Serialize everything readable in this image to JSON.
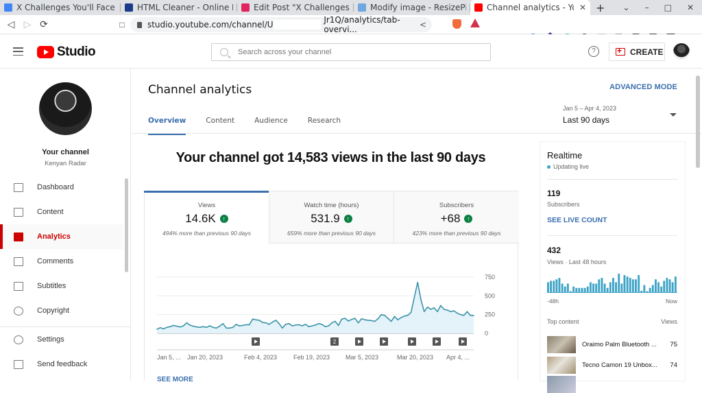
{
  "browser": {
    "tabs": [
      {
        "title": "X Challenges You'll Face Whe",
        "favicon": "docs-icon",
        "color": "#4285f4",
        "active": false
      },
      {
        "title": "HTML Cleaner - Online Beau",
        "favicon": "html-cleaner-icon",
        "color": "#1a3a8a",
        "active": false
      },
      {
        "title": "Edit Post \"X Challenges You'",
        "favicon": "k-icon",
        "color": "#e0245e",
        "active": false
      },
      {
        "title": "Modify image - ResizePixel",
        "favicon": "resizepixel-icon",
        "color": "#6fa8dc",
        "active": false
      },
      {
        "title": "Channel analytics - YouT",
        "favicon": "youtube-icon",
        "color": "#ff0000",
        "active": true
      }
    ],
    "new_tab": "+",
    "url_prefix": "studio.youtube.com/channel/U",
    "url_suffix": "Jr1Q/analytics/tab-overvi..."
  },
  "header": {
    "logo_text": "Studio",
    "search_placeholder": "Search across your channel",
    "help": "?",
    "create_label": "CREATE"
  },
  "sidebar": {
    "channel_title": "Your channel",
    "channel_name": "Kenyan Radar",
    "items": [
      {
        "label": "Dashboard",
        "icon": "dashboard-icon",
        "active": false
      },
      {
        "label": "Content",
        "icon": "content-icon",
        "active": false
      },
      {
        "label": "Analytics",
        "icon": "analytics-icon",
        "active": true
      },
      {
        "label": "Comments",
        "icon": "comments-icon",
        "active": false
      },
      {
        "label": "Subtitles",
        "icon": "subtitles-icon",
        "active": false
      },
      {
        "label": "Copyright",
        "icon": "copyright-icon",
        "active": false
      }
    ],
    "bottom_items": [
      {
        "label": "Settings",
        "icon": "settings-icon"
      },
      {
        "label": "Send feedback",
        "icon": "feedback-icon"
      }
    ]
  },
  "main": {
    "title": "Channel analytics",
    "advanced_mode": "ADVANCED MODE",
    "tabs": [
      "Overview",
      "Content",
      "Audience",
      "Research"
    ],
    "active_tab": "Overview",
    "date_range_small": "Jan 5 – Apr 4, 2023",
    "date_range_label": "Last 90 days",
    "headline": "Your channel got 14,583 views in the last 90 days",
    "metrics": [
      {
        "label": "Views",
        "value": "14.6K",
        "compare": "494% more than previous 90 days",
        "trend": "up"
      },
      {
        "label": "Watch time (hours)",
        "value": "531.9",
        "compare": "659% more than previous 90 days",
        "trend": "up"
      },
      {
        "label": "Subscribers",
        "value": "+68",
        "compare": "423% more than previous 90 days",
        "trend": "up"
      }
    ],
    "see_more": "SEE MORE"
  },
  "chart_data": {
    "type": "area",
    "title": "Views",
    "xlabel": "",
    "ylabel": "",
    "ylim": [
      0,
      750
    ],
    "y_ticks": [
      0,
      250,
      500,
      750
    ],
    "x_tick_labels": [
      "Jan 5, ...",
      "Jan 20, 2023",
      "Feb 4, 2023",
      "Feb 19, 2023",
      "Mar 5, 2023",
      "Mar 20, 2023",
      "Apr 4, ..."
    ],
    "grid": true,
    "line_color": "#3b93a8",
    "fill_color": "#e3f3f9",
    "series": [
      {
        "name": "Views",
        "values": [
          55,
          75,
          60,
          80,
          90,
          105,
          95,
          85,
          100,
          140,
          110,
          95,
          85,
          80,
          90,
          80,
          100,
          80,
          70,
          95,
          130,
          70,
          70,
          80,
          120,
          100,
          105,
          115,
          115,
          190,
          180,
          175,
          145,
          140,
          120,
          150,
          175,
          130,
          70,
          120,
          130,
          100,
          110,
          115,
          100,
          120,
          90,
          100,
          110,
          130,
          120,
          90,
          100,
          140,
          160,
          105,
          190,
          200,
          165,
          185,
          200,
          140,
          195,
          180,
          175,
          170,
          160,
          195,
          250,
          240,
          200,
          160,
          225,
          180,
          210,
          230,
          240,
          280,
          480,
          680,
          450,
          290,
          350,
          320,
          340,
          290,
          370,
          320,
          310,
          290,
          300,
          270,
          250,
          240,
          290,
          240,
          235
        ]
      }
    ],
    "video_markers": [
      {
        "date_index": 49,
        "label": "play"
      },
      {
        "date_index": 43,
        "label": "2",
        "override_pos": 0.485
      },
      {
        "date_index": 54,
        "label": "play"
      },
      {
        "date_index": 61,
        "label": "play"
      },
      {
        "date_index": 71,
        "label": "play"
      },
      {
        "date_index": 78,
        "label": "play"
      },
      {
        "date_index": 86,
        "label": "play"
      },
      {
        "date_index": 93,
        "label": "play"
      }
    ]
  },
  "realtime": {
    "title": "Realtime",
    "status": "Updating live",
    "subscribers": "119",
    "subscribers_label": "Subscribers",
    "see_live_count": "SEE LIVE COUNT",
    "views": "432",
    "views_label": "Views · Last 48 hours",
    "axis_start": "-48h",
    "axis_end": "Now",
    "bar_color": "#3ea3c6",
    "hourly_views": [
      7,
      8,
      8,
      9,
      10,
      6,
      4,
      6,
      0,
      4,
      3,
      3,
      3,
      3,
      4,
      7,
      6,
      6,
      9,
      10,
      6,
      3,
      7,
      10,
      7,
      13,
      6,
      12,
      11,
      10,
      9,
      9,
      12,
      1,
      5,
      0,
      3,
      5,
      9,
      7,
      4,
      8,
      10,
      9,
      7,
      11
    ],
    "top_content_label": "Top content",
    "views_col_label": "Views",
    "top_content": [
      {
        "title": "Oraimo Palm Bluetooth ...",
        "views": "75"
      },
      {
        "title": "Tecno Camon 19 Unbox...",
        "views": "74"
      }
    ]
  }
}
